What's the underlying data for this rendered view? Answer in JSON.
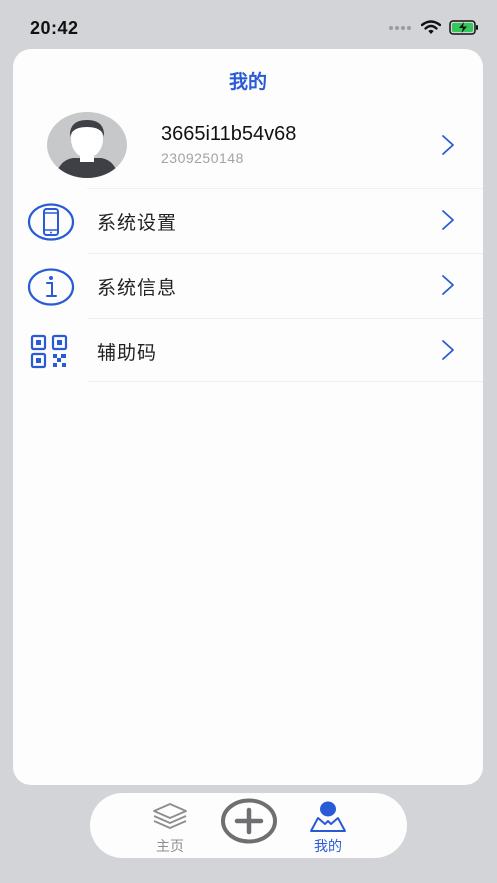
{
  "status_bar": {
    "time": "20:42",
    "icons": [
      "signal-dots-icon",
      "wifi-icon",
      "battery-charging-icon"
    ]
  },
  "page": {
    "title": "我的"
  },
  "profile": {
    "username": "3665i11b54v68",
    "user_id": "2309250148"
  },
  "menu": {
    "items": [
      {
        "label": "系统设置",
        "icon": "phone-icon"
      },
      {
        "label": "系统信息",
        "icon": "info-icon"
      },
      {
        "label": "辅助码",
        "icon": "qr-code-icon"
      }
    ]
  },
  "tabbar": {
    "home_label": "主页",
    "add_icon": "plus-circle-icon",
    "mine_label": "我的"
  },
  "colors": {
    "accent": "#2a5bd7",
    "background": "#d2d4d7",
    "card": "#fdfdfd",
    "tab_inactive": "#8e8e90"
  }
}
